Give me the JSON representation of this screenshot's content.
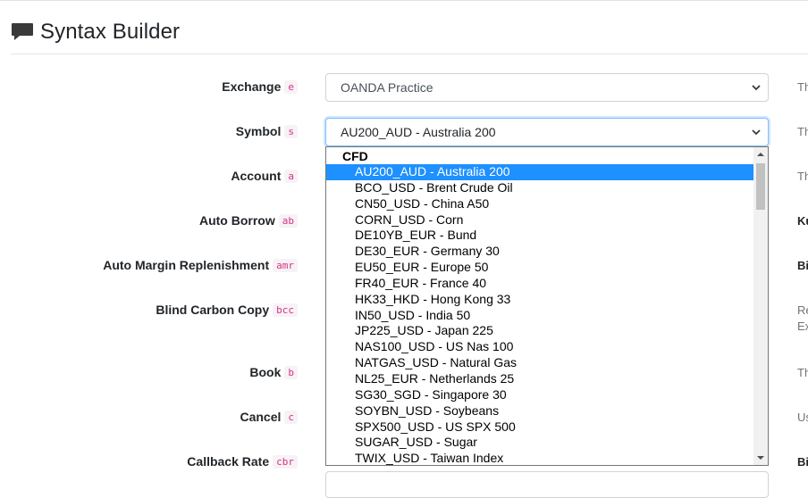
{
  "header": {
    "title": "Syntax Builder",
    "icon": "speech-bubble-icon"
  },
  "fields": [
    {
      "label": "Exchange",
      "code": "e"
    },
    {
      "label": "Symbol",
      "code": "s"
    },
    {
      "label": "Account",
      "code": "a"
    },
    {
      "label": "Auto Borrow",
      "code": "ab"
    },
    {
      "label": "Auto Margin Replenishment",
      "code": "amr"
    },
    {
      "label": "Blind Carbon Copy",
      "code": "bcc"
    },
    {
      "label": "Book",
      "code": "b"
    },
    {
      "label": "Cancel",
      "code": "c"
    },
    {
      "label": "Callback Rate",
      "code": "cbr"
    }
  ],
  "exchange_select": {
    "value": "OANDA Practice"
  },
  "symbol_select": {
    "value": "AU200_AUD - Australia 200"
  },
  "help_text": [
    "Th",
    "Th",
    "Th",
    "Ku",
    "Bi",
    "Re",
    "Ex",
    "Th",
    "Us",
    "Bi"
  ],
  "dropdown": {
    "group": "CFD",
    "selected_index": 0,
    "options": [
      "AU200_AUD - Australia 200",
      "BCO_USD - Brent Crude Oil",
      "CN50_USD - China A50",
      "CORN_USD - Corn",
      "DE10YB_EUR - Bund",
      "DE30_EUR - Germany 30",
      "EU50_EUR - Europe 50",
      "FR40_EUR - France 40",
      "HK33_HKD - Hong Kong 33",
      "IN50_USD - India 50",
      "JP225_USD - Japan 225",
      "NAS100_USD - US Nas 100",
      "NATGAS_USD - Natural Gas",
      "NL25_EUR - Netherlands 25",
      "SG30_SGD - Singapore 30",
      "SOYBN_USD - Soybeans",
      "SPX500_USD - US SPX 500",
      "SUGAR_USD - Sugar",
      "TWIX_USD - Taiwan Index"
    ]
  },
  "colors": {
    "selected_option": "#1e90ff",
    "code_text": "#d63384",
    "focus_border": "#80bdff"
  }
}
